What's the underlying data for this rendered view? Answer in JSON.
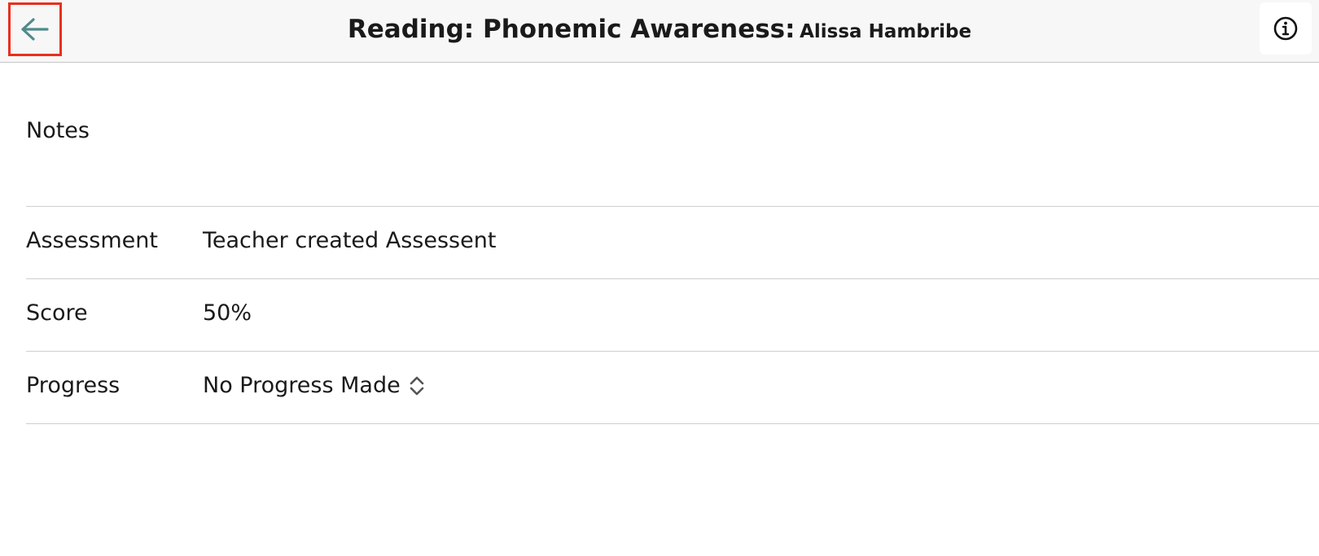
{
  "header": {
    "title": "Reading: Phonemic Awareness:",
    "student_name": "Alissa Hambribe",
    "back_icon": "arrow-left-icon",
    "info_icon": "info-circle-icon"
  },
  "notes": {
    "label": "Notes"
  },
  "rows": [
    {
      "label": "Assessment",
      "value": "Teacher created Assessent"
    },
    {
      "label": "Score",
      "value": "50%"
    },
    {
      "label": "Progress",
      "value": "No Progress Made"
    }
  ],
  "colors": {
    "back_arrow": "#4f8a8b",
    "highlight_border": "#e8301c",
    "header_bg": "#f7f7f7"
  }
}
